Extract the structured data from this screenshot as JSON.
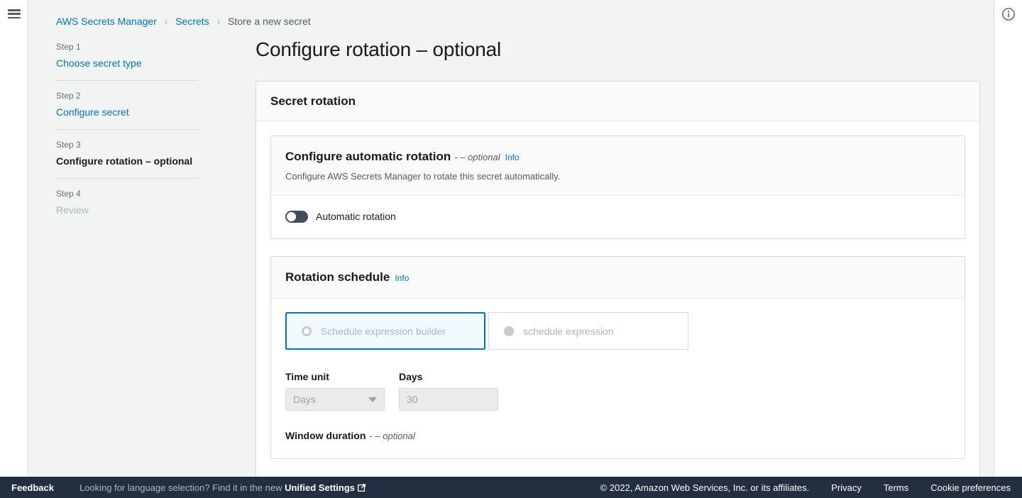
{
  "chrome": {
    "menu_icon": "hamburger-icon",
    "info_panel_icon": "info-circle-icon"
  },
  "breadcrumb": {
    "items": [
      {
        "label": "AWS Secrets Manager",
        "type": "link"
      },
      {
        "label": "Secrets",
        "type": "link"
      },
      {
        "label": "Store a new secret",
        "type": "current"
      }
    ],
    "separator": "›"
  },
  "wizard": {
    "steps": [
      {
        "number": "Step 1",
        "label": "Choose secret type",
        "state": "link"
      },
      {
        "number": "Step 2",
        "label": "Configure secret",
        "state": "link"
      },
      {
        "number": "Step 3",
        "label": "Configure rotation – optional",
        "state": "active"
      },
      {
        "number": "Step 4",
        "label": "Review",
        "state": "disabled"
      }
    ]
  },
  "main": {
    "page_title": "Configure rotation – optional",
    "container_header": "Secret rotation",
    "automatic_rotation": {
      "title": "Configure automatic rotation",
      "optional_suffix": "- – optional",
      "info_label": "Info",
      "description": "Configure AWS Secrets Manager to rotate this secret automatically.",
      "toggle_label": "Automatic rotation",
      "toggle_state": "off"
    },
    "rotation_schedule": {
      "title": "Rotation schedule",
      "info_label": "Info",
      "options": [
        {
          "label": "Schedule expression builder",
          "selected": true,
          "disabled": true
        },
        {
          "label": "schedule expression",
          "selected": false,
          "disabled": true
        }
      ],
      "time_unit": {
        "label": "Time unit",
        "value": "Days",
        "disabled": true
      },
      "days": {
        "label": "Days",
        "value": "30",
        "disabled": true
      },
      "window_duration": {
        "label": "Window duration",
        "optional_suffix": "- – optional"
      }
    }
  },
  "footer": {
    "feedback": "Feedback",
    "language_notice_prefix": "Looking for language selection? Find it in the new ",
    "language_notice_link": "Unified Settings",
    "external_icon": "external-link-icon",
    "copyright": "© 2022, Amazon Web Services, Inc. or its affiliates.",
    "links": [
      "Privacy",
      "Terms",
      "Cookie preferences"
    ]
  },
  "colors": {
    "accent_link": "#0073bb",
    "footer_bg": "#232f3e",
    "page_bg": "#f2f3f3",
    "selected_tile_bg": "#f1faff",
    "toggle_off": "#414d5c"
  }
}
